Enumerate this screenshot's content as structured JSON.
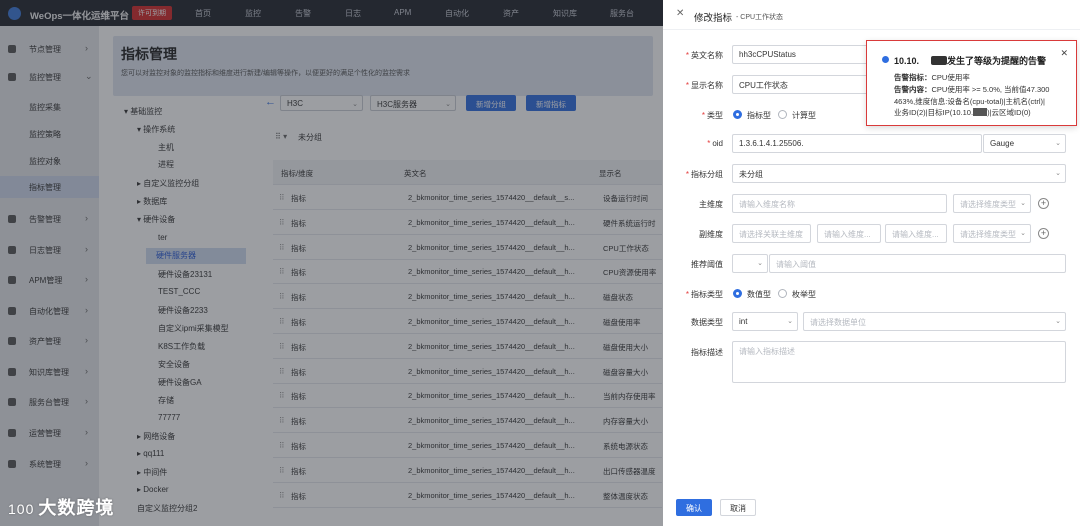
{
  "topbar": {
    "title": "WeOps一体化运维平台",
    "license": "许可到期",
    "nav": [
      "首页",
      "监控",
      "告警",
      "日志",
      "APM",
      "自动化",
      "资产",
      "知识库",
      "服务台"
    ]
  },
  "sidebar": {
    "items": [
      {
        "label": "节点管理",
        "arrow": "›"
      },
      {
        "label": "监控管理",
        "arrow": "⌄"
      },
      {
        "label": "监控采集"
      },
      {
        "label": "监控策略"
      },
      {
        "label": "监控对象"
      },
      {
        "label": "指标管理"
      },
      {
        "label": "告警管理",
        "arrow": "›"
      },
      {
        "label": "日志管理",
        "arrow": "›"
      },
      {
        "label": "APM管理",
        "arrow": "›"
      },
      {
        "label": "自动化管理",
        "arrow": "›"
      },
      {
        "label": "资产管理",
        "arrow": "›"
      },
      {
        "label": "知识库管理",
        "arrow": "›"
      },
      {
        "label": "服务台管理",
        "arrow": "›"
      },
      {
        "label": "运营管理",
        "arrow": "›"
      },
      {
        "label": "系统管理",
        "arrow": "›"
      }
    ]
  },
  "page": {
    "title": "指标管理",
    "desc": "您可以对监控对象的监控指标和维度进行新建/编辑等操作，以便更好的满足个性化的监控需求"
  },
  "tree": {
    "items": [
      {
        "label": "▾ 基础监控"
      },
      {
        "label": "▾ 操作系统"
      },
      {
        "label": "主机"
      },
      {
        "label": "进程"
      },
      {
        "label": "▸ 自定义监控分组"
      },
      {
        "label": "▸ 数据库"
      },
      {
        "label": "▾ 硬件设备"
      },
      {
        "label": "ter"
      },
      {
        "label": "硬件服务器"
      },
      {
        "label": "硬件设备23131"
      },
      {
        "label": "TEST_CCC"
      },
      {
        "label": "硬件设备2233"
      },
      {
        "label": "自定义ipmi采集模型"
      },
      {
        "label": "K8S工作负载"
      },
      {
        "label": "安全设备"
      },
      {
        "label": "硬件设备GA"
      },
      {
        "label": "存储"
      },
      {
        "label": "77777"
      },
      {
        "label": "▸ 网络设备"
      },
      {
        "label": "▸ qq111"
      },
      {
        "label": "▸ 中间件"
      },
      {
        "label": "▸ Docker"
      },
      {
        "label": "自定义监控分组2"
      }
    ]
  },
  "filters": {
    "back": "←",
    "vendor": "H3C",
    "model": "H3C服务器",
    "add_group": "新增分组",
    "add_metric": "新增指标",
    "group_label": "未分组"
  },
  "table": {
    "headers": [
      "指标/维度",
      "英文名",
      "显示名"
    ],
    "rows": [
      {
        "type": "指标",
        "en": "2_bkmonitor_time_series_1574420__default__s...",
        "cn": "设备运行时间"
      },
      {
        "type": "指标",
        "en": "2_bkmonitor_time_series_1574420__default__h...",
        "cn": "硬件系统运行时"
      },
      {
        "type": "指标",
        "en": "2_bkmonitor_time_series_1574420__default__h...",
        "cn": "CPU工作状态"
      },
      {
        "type": "指标",
        "en": "2_bkmonitor_time_series_1574420__default__h...",
        "cn": "CPU资源使用率"
      },
      {
        "type": "指标",
        "en": "2_bkmonitor_time_series_1574420__default__h...",
        "cn": "磁盘状态"
      },
      {
        "type": "指标",
        "en": "2_bkmonitor_time_series_1574420__default__h...",
        "cn": "磁盘使用率"
      },
      {
        "type": "指标",
        "en": "2_bkmonitor_time_series_1574420__default__h...",
        "cn": "磁盘使用大小"
      },
      {
        "type": "指标",
        "en": "2_bkmonitor_time_series_1574420__default__h...",
        "cn": "磁盘容量大小"
      },
      {
        "type": "指标",
        "en": "2_bkmonitor_time_series_1574420__default__h...",
        "cn": "当前内存使用率"
      },
      {
        "type": "指标",
        "en": "2_bkmonitor_time_series_1574420__default__h...",
        "cn": "内存容量大小"
      },
      {
        "type": "指标",
        "en": "2_bkmonitor_time_series_1574420__default__h...",
        "cn": "系统电源状态"
      },
      {
        "type": "指标",
        "en": "2_bkmonitor_time_series_1574420__default__h...",
        "cn": "出口传感器温度"
      },
      {
        "type": "指标",
        "en": "2_bkmonitor_time_series_1574420__default__h...",
        "cn": "整体温度状态"
      }
    ]
  },
  "drawer": {
    "close": "✕",
    "title": "修改指标",
    "subtitle": "- CPU工作状态",
    "labels": {
      "en_name": "英文名称",
      "display_name": "显示名称",
      "type": "类型",
      "oid": "oid",
      "group": "指标分组",
      "main_dim": "主维度",
      "sub_dim": "副维度",
      "threshold": "推荐阈值",
      "metric_type": "指标类型",
      "data_type": "数据类型",
      "desc": "指标描述"
    },
    "values": {
      "en_name": "hh3cCPUStatus",
      "display_name": "CPU工作状态",
      "type_opt1": "指标型",
      "type_opt2": "计算型",
      "oid": "1.3.6.1.4.1.25506.",
      "oid_type": "Gauge",
      "group": "未分组",
      "metric_type_opt1": "数值型",
      "metric_type_opt2": "枚举型",
      "data_type": "int"
    },
    "placeholders": {
      "main_dim_name": "请输入维度名称",
      "main_dim_type": "请选择维度类型",
      "sub_dim_main": "请选择关联主维度",
      "sub_dim_name": "请输入维度...",
      "sub_dim_name2": "请输入维度...",
      "sub_dim_type": "请选择维度类型",
      "threshold": "请输入阈值",
      "unit": "请选择数据单位",
      "desc": "请输入指标描述"
    },
    "confirm": "确认",
    "cancel": "取消"
  },
  "toast": {
    "title_prefix": "10.10.",
    "title_suffix": "发生了等级为提醒的告警",
    "close": "✕",
    "line1_key": "告警指标：",
    "line1_val": "CPU使用率",
    "line2_key": "告警内容：",
    "line2_val": "CPU使用率 >= 5.0%, 当前值47.300",
    "line3": "463%,维度信息:设备名(cpu-total)|主机名(ctrl)|",
    "line4_a": "业务ID(2)|目标IP(10.10.",
    "line4_b": ")|云区域ID(0)"
  },
  "watermark": {
    "logo": "100",
    "text": "大数跨境"
  }
}
